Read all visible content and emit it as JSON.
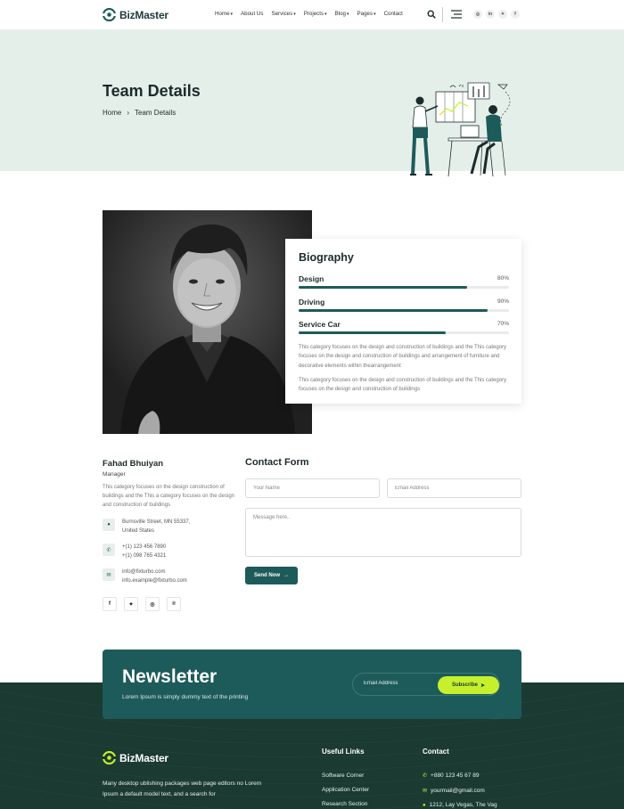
{
  "brand": {
    "name": "BizMaster",
    "accent": "#1d5b5a",
    "lime": "#c6f02b",
    "footer_bg": "#1b3a31"
  },
  "nav": {
    "items": [
      {
        "label": "Home",
        "dropdown": true
      },
      {
        "label": "About Us",
        "dropdown": false
      },
      {
        "label": "Services",
        "dropdown": true
      },
      {
        "label": "Projects",
        "dropdown": true
      },
      {
        "label": "Blog",
        "dropdown": true
      },
      {
        "label": "Pages",
        "dropdown": true
      },
      {
        "label": "Contact",
        "dropdown": false
      }
    ],
    "caret": "▾",
    "icons": [
      "search-icon",
      "menu-icon"
    ],
    "socials": [
      {
        "name": "instagram-icon",
        "glyph": "◎"
      },
      {
        "name": "linkedin-icon",
        "glyph": "in"
      },
      {
        "name": "twitter-icon",
        "glyph": "✦"
      },
      {
        "name": "facebook-icon",
        "glyph": "f"
      }
    ]
  },
  "hero": {
    "title": "Team Details",
    "breadcrumb": {
      "home": "Home",
      "separator": "›",
      "current": "Team Details"
    }
  },
  "biography": {
    "title": "Biography",
    "skills": [
      {
        "name": "Design",
        "percent_label": "80%",
        "value": 80
      },
      {
        "name": "Driving",
        "percent_label": "90%",
        "value": 90
      },
      {
        "name": "Service Car",
        "percent_label": "70%",
        "value": 70
      }
    ],
    "paragraph1": "This category focuses on the design and construction of buildings and the This category focuses on the design and construction of buildings and arrangement of furniture and decorative elements within thearrangement",
    "paragraph2": "This category focuses on the design and construction of buildings and the This category focuses on the design and construction of buildings"
  },
  "person": {
    "name": "Fahad Bhuiyan",
    "role": "Manager",
    "description": "This category focuses on the design construction of buildings and the This a category focuses on the design and construction of buildings",
    "address_line1": "Burnsville Street, MN 55337,",
    "address_line2": "United States",
    "phone1": "+(1) 123 456 7890",
    "phone2": "+(1) 098 765 4321",
    "email1": "info@fixturbo.com",
    "email2": "info.example@fixturbo.com",
    "socials": [
      {
        "name": "facebook-icon",
        "glyph": "f"
      },
      {
        "name": "twitter-icon",
        "glyph": "✦"
      },
      {
        "name": "instagram-icon",
        "glyph": "◎"
      },
      {
        "name": "pinterest-icon",
        "glyph": "℗"
      }
    ]
  },
  "contact_form": {
    "title": "Contact Form",
    "name_placeholder": "Your Name",
    "email_placeholder": "Email Address",
    "message_placeholder": "Message here..",
    "submit_label": "Send Now",
    "submit_arrow": "→"
  },
  "newsletter": {
    "title": "Newsletter",
    "subtitle": "Lorem Ipsum is simply dummy text of the printing",
    "email_placeholder": "Email Address",
    "button_label": "Subscribe",
    "button_icon": "➤"
  },
  "footer": {
    "brand": "BizMaster",
    "description": "Many desktop ublishing packages web page editors no Lorem Ipsum a default model text, and a search for",
    "links_title": "Useful Links",
    "links": [
      "Software Corner",
      "Application Center",
      "Research Section"
    ],
    "contact_title": "Contact",
    "phone": "+880 123 45 67 89",
    "email": "yourmail@gmail.com",
    "address": "1212, Lay Vegas, The Vag"
  }
}
